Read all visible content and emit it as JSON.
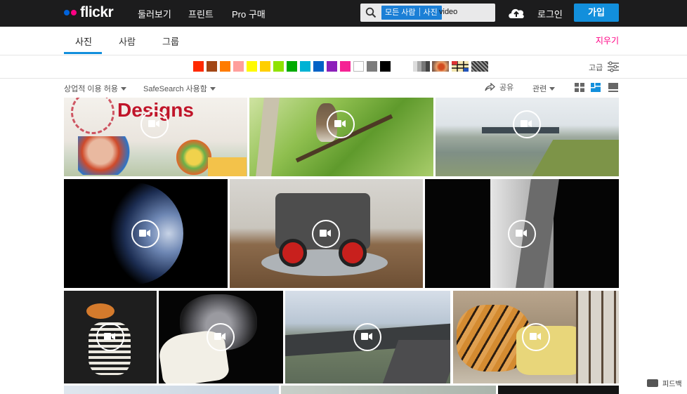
{
  "header": {
    "logo_text": "flickr",
    "nav": [
      "둘러보기",
      "프린트",
      "Pro 구매"
    ],
    "search": {
      "scope": [
        "모든 사람",
        "사진"
      ],
      "query": "video"
    },
    "login_label": "로그인",
    "signup_label": "가입"
  },
  "tabs": {
    "items": [
      "사진",
      "사람",
      "그룹"
    ],
    "active": "사진",
    "clear_label": "지우기"
  },
  "color_filter": {
    "swatches": [
      "#ff2a00",
      "#a24615",
      "#ff7c00",
      "#ff9f9c",
      "#fffa00",
      "#ffcf00",
      "#90e200",
      "#00ab00",
      "#00b2d4",
      "#0062c6",
      "#8c20ba",
      "#f52394",
      "#ffffff",
      "#7c7c7c",
      "#000000"
    ],
    "patterns": [
      "black-and-white-pattern",
      "shallow-depth-of-field-pattern",
      "minimalist-pattern",
      "pattern-pattern"
    ],
    "advanced_label": "고급"
  },
  "filters": {
    "license": "상업적 이용 허용",
    "safesearch": "SafeSearch 사용함",
    "share": "공유",
    "sort": "관련"
  },
  "photos": [
    {
      "id": "free-designs-painting",
      "kind": "video"
    },
    {
      "id": "bird-on-branch",
      "kind": "video"
    },
    {
      "id": "river-boat",
      "kind": "video"
    },
    {
      "id": "earth-from-space",
      "kind": "video"
    },
    {
      "id": "lego-rover",
      "kind": "video"
    },
    {
      "id": "wall-corner",
      "kind": "video"
    },
    {
      "id": "skeleton-figurine",
      "kind": "video"
    },
    {
      "id": "cat-with-bread",
      "kind": "video"
    },
    {
      "id": "race-track",
      "kind": "video"
    },
    {
      "id": "tiger-cat",
      "kind": "video"
    }
  ],
  "photo_tile_text": "Designs",
  "feedback_label": "피드백"
}
